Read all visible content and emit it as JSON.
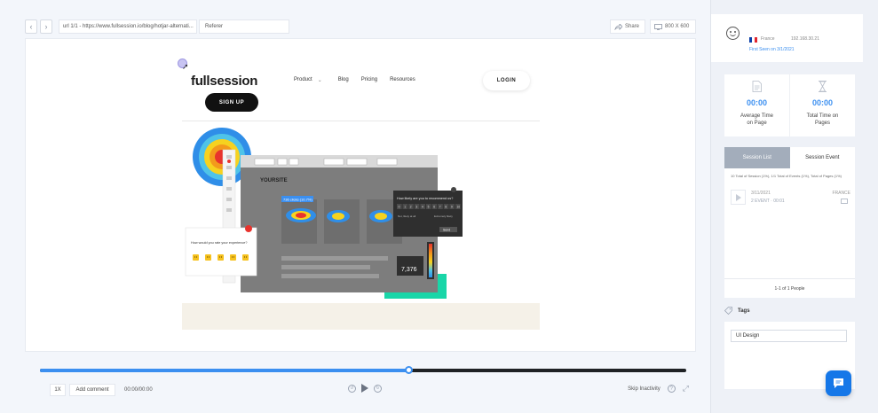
{
  "toolbar": {
    "url": "url 1/1 - https://www.fullsession.io/blog/hotjar-alternati...",
    "referer": "Referer",
    "share_label": "Share",
    "viewport_size": "800 X 600"
  },
  "site": {
    "logo": "fullsession",
    "menu": [
      "Product",
      "Blog",
      "Pricing",
      "Resources"
    ],
    "login": "LOGIN",
    "signup": "SIGN UP",
    "hero": {
      "clicks_label": "736 clicks (10.7%)",
      "nps_question": "How likely are you to recommend us?",
      "nps_scale": [
        "0",
        "1",
        "2",
        "3",
        "4",
        "5",
        "6",
        "7",
        "8",
        "9",
        "10"
      ],
      "nps_low": "Not, likely at all",
      "nps_high": "Extremely likely",
      "nps_send": "Send",
      "survey_question": "How would you rate your experience?",
      "counter": "7,376",
      "site_logo": "YOURSITE"
    }
  },
  "player": {
    "progress": 0.57,
    "speed": "1X",
    "add_comment": "Add comment",
    "timecode": "00:00/00:00",
    "skip_inactivity": "Skip Inactivity"
  },
  "visitor": {
    "country": "France",
    "ip": "192.168.30.21",
    "first_seen": "First Seen on 3/1/2021",
    "flag_colors": [
      "#0a3ea8",
      "#ffffff",
      "#e0252f"
    ]
  },
  "stats": [
    {
      "icon": "document-icon",
      "value": "00:00",
      "label": "Average Time on Page"
    },
    {
      "icon": "hourglass-icon",
      "value": "00:00",
      "label": "Total Time on Pages"
    }
  ],
  "sessions": {
    "tabs": [
      "Session List",
      "Session Event"
    ],
    "summary": "10 Total of Session (1%), 1/1 Total of Events (1%), Total of Pages (1%)",
    "row": {
      "date": "3/11/2021",
      "events": "2 EVENT · 00:01",
      "country": "FRANCE"
    },
    "footer": "1-1 of 1 People"
  },
  "tags": {
    "title": "Tags",
    "value": "UI Design"
  },
  "colors": {
    "accent": "#3b8ff0",
    "chat": "#1577e8",
    "tab_active": "#a3adbb"
  }
}
